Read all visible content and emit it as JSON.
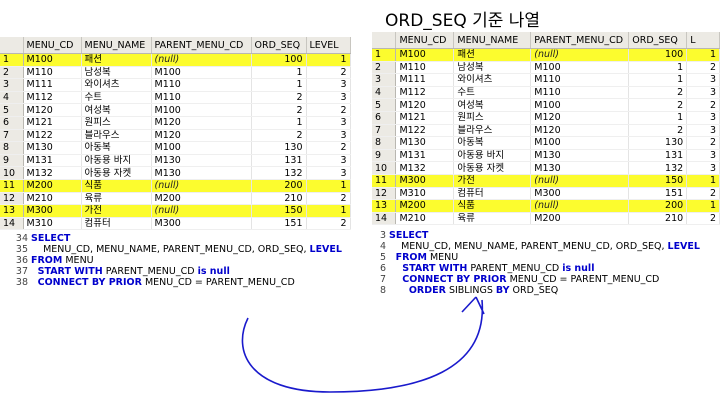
{
  "title": "ORD_SEQ 기준 나열",
  "left_grid": {
    "columns": [
      "",
      "MENU_CD",
      "MENU_NAME",
      "PARENT_MENU_CD",
      "ORD_SEQ",
      "LEVEL"
    ],
    "rows": [
      {
        "n": "1",
        "cd": "M100",
        "name": "패션",
        "parent": "(null)",
        "seq": "100",
        "lvl": "1",
        "hl": true
      },
      {
        "n": "2",
        "cd": "M110",
        "name": "남성복",
        "parent": "M100",
        "seq": "1",
        "lvl": "2",
        "hl": false
      },
      {
        "n": "3",
        "cd": "M111",
        "name": "와이셔츠",
        "parent": "M110",
        "seq": "1",
        "lvl": "3",
        "hl": false
      },
      {
        "n": "4",
        "cd": "M112",
        "name": "수트",
        "parent": "M110",
        "seq": "2",
        "lvl": "3",
        "hl": false
      },
      {
        "n": "5",
        "cd": "M120",
        "name": "여성복",
        "parent": "M100",
        "seq": "2",
        "lvl": "2",
        "hl": false
      },
      {
        "n": "6",
        "cd": "M121",
        "name": "원피스",
        "parent": "M120",
        "seq": "1",
        "lvl": "3",
        "hl": false
      },
      {
        "n": "7",
        "cd": "M122",
        "name": "블라우스",
        "parent": "M120",
        "seq": "2",
        "lvl": "3",
        "hl": false
      },
      {
        "n": "8",
        "cd": "M130",
        "name": "아동복",
        "parent": "M100",
        "seq": "130",
        "lvl": "2",
        "hl": false
      },
      {
        "n": "9",
        "cd": "M131",
        "name": "아동용 바지",
        "parent": "M130",
        "seq": "131",
        "lvl": "3",
        "hl": false
      },
      {
        "n": "10",
        "cd": "M132",
        "name": "아동용 자켓",
        "parent": "M130",
        "seq": "132",
        "lvl": "3",
        "hl": false
      },
      {
        "n": "11",
        "cd": "M200",
        "name": "식품",
        "parent": "(null)",
        "seq": "200",
        "lvl": "1",
        "hl": true
      },
      {
        "n": "12",
        "cd": "M210",
        "name": "육류",
        "parent": "M200",
        "seq": "210",
        "lvl": "2",
        "hl": false
      },
      {
        "n": "13",
        "cd": "M300",
        "name": "가전",
        "parent": "(null)",
        "seq": "150",
        "lvl": "1",
        "hl": true
      },
      {
        "n": "14",
        "cd": "M310",
        "name": "컴퓨터",
        "parent": "M300",
        "seq": "151",
        "lvl": "2",
        "hl": false
      }
    ]
  },
  "right_grid": {
    "columns": [
      "",
      "MENU_CD",
      "MENU_NAME",
      "PARENT_MENU_CD",
      "ORD_SEQ",
      "L"
    ],
    "rows": [
      {
        "n": "1",
        "cd": "M100",
        "name": "패션",
        "parent": "(null)",
        "seq": "100",
        "lvl": "1",
        "hl": true
      },
      {
        "n": "2",
        "cd": "M110",
        "name": "남성복",
        "parent": "M100",
        "seq": "1",
        "lvl": "2",
        "hl": false
      },
      {
        "n": "3",
        "cd": "M111",
        "name": "와이셔츠",
        "parent": "M110",
        "seq": "1",
        "lvl": "3",
        "hl": false
      },
      {
        "n": "4",
        "cd": "M112",
        "name": "수트",
        "parent": "M110",
        "seq": "2",
        "lvl": "3",
        "hl": false
      },
      {
        "n": "5",
        "cd": "M120",
        "name": "여성복",
        "parent": "M100",
        "seq": "2",
        "lvl": "2",
        "hl": false
      },
      {
        "n": "6",
        "cd": "M121",
        "name": "원피스",
        "parent": "M120",
        "seq": "1",
        "lvl": "3",
        "hl": false
      },
      {
        "n": "7",
        "cd": "M122",
        "name": "블라우스",
        "parent": "M120",
        "seq": "2",
        "lvl": "3",
        "hl": false
      },
      {
        "n": "8",
        "cd": "M130",
        "name": "아동복",
        "parent": "M100",
        "seq": "130",
        "lvl": "2",
        "hl": false
      },
      {
        "n": "9",
        "cd": "M131",
        "name": "아동용 바지",
        "parent": "M130",
        "seq": "131",
        "lvl": "3",
        "hl": false
      },
      {
        "n": "10",
        "cd": "M132",
        "name": "아동용 자켓",
        "parent": "M130",
        "seq": "132",
        "lvl": "3",
        "hl": false
      },
      {
        "n": "11",
        "cd": "M300",
        "name": "가전",
        "parent": "(null)",
        "seq": "150",
        "lvl": "1",
        "hl": true
      },
      {
        "n": "12",
        "cd": "M310",
        "name": "컴퓨터",
        "parent": "M300",
        "seq": "151",
        "lvl": "2",
        "hl": false
      },
      {
        "n": "13",
        "cd": "M200",
        "name": "식품",
        "parent": "(null)",
        "seq": "200",
        "lvl": "1",
        "hl": true
      },
      {
        "n": "14",
        "cd": "M210",
        "name": "육류",
        "parent": "M200",
        "seq": "210",
        "lvl": "2",
        "hl": false
      }
    ]
  },
  "left_sql": [
    {
      "ln": "34",
      "parts": [
        {
          "t": "SELECT",
          "kw": true
        }
      ]
    },
    {
      "ln": "35",
      "parts": [
        {
          "t": "    MENU_CD, MENU_NAME, PARENT_MENU_CD, ORD_SEQ, ",
          "kw": false
        },
        {
          "t": "LEVEL",
          "kw": true
        }
      ]
    },
    {
      "ln": "36",
      "parts": [
        {
          "t": "FROM",
          "kw": true
        },
        {
          "t": " MENU",
          "kw": false
        }
      ]
    },
    {
      "ln": "37",
      "parts": [
        {
          "t": "  START WITH",
          "kw": true
        },
        {
          "t": " PARENT_MENU_CD ",
          "kw": false
        },
        {
          "t": "is null",
          "kw": true
        }
      ]
    },
    {
      "ln": "38",
      "parts": [
        {
          "t": "  CONNECT BY PRIOR",
          "kw": true
        },
        {
          "t": " MENU_CD = PARENT_MENU_CD",
          "kw": false
        }
      ]
    }
  ],
  "right_sql": [
    {
      "ln": "3",
      "parts": [
        {
          "t": "SELECT",
          "kw": true
        }
      ]
    },
    {
      "ln": "4",
      "parts": [
        {
          "t": "    MENU_CD, MENU_NAME, PARENT_MENU_CD, ORD_SEQ, ",
          "kw": false
        },
        {
          "t": "LEVEL",
          "kw": true
        }
      ]
    },
    {
      "ln": "5",
      "parts": [
        {
          "t": "  FROM",
          "kw": true
        },
        {
          "t": " MENU",
          "kw": false
        }
      ]
    },
    {
      "ln": "6",
      "parts": [
        {
          "t": "    START WITH",
          "kw": true
        },
        {
          "t": " PARENT_MENU_CD ",
          "kw": false
        },
        {
          "t": "is null",
          "kw": true
        }
      ]
    },
    {
      "ln": "7",
      "parts": [
        {
          "t": "    CONNECT BY PRIOR",
          "kw": true
        },
        {
          "t": " MENU_CD = PARENT_MENU_CD",
          "kw": false
        }
      ]
    },
    {
      "ln": "8",
      "parts": [
        {
          "t": "      ORDER",
          "kw": true
        },
        {
          "t": " SIBLINGS ",
          "kw": false
        },
        {
          "t": "BY",
          "kw": true
        },
        {
          "t": " ORD_SEQ",
          "kw": false
        }
      ]
    }
  ],
  "colors": {
    "highlight": "#fcfc2e",
    "keyword": "#0000cc",
    "arrow": "#1a1acc"
  }
}
